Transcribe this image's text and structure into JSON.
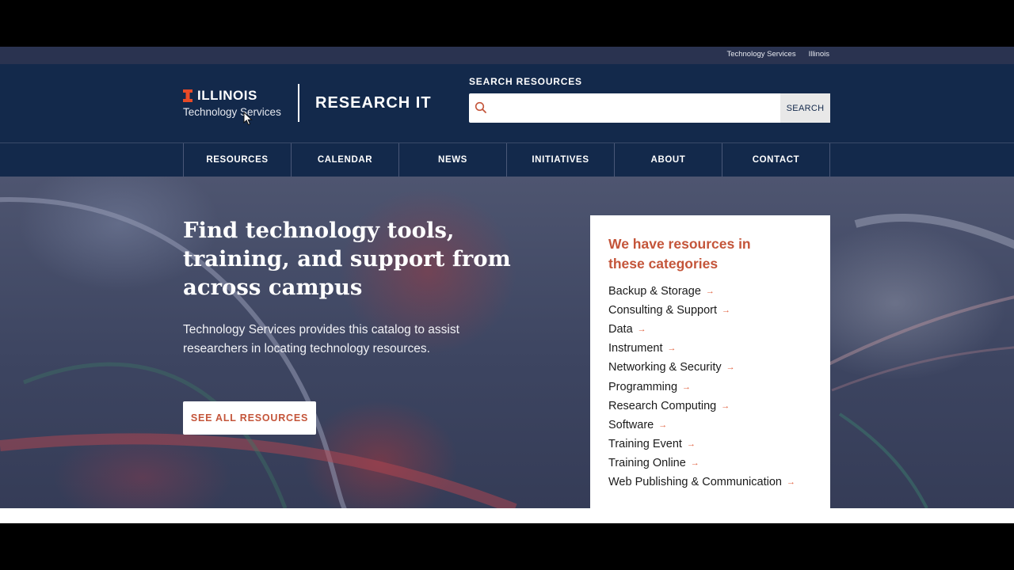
{
  "utility": {
    "links": [
      "Technology Services",
      "Illinois"
    ]
  },
  "brand": {
    "name": "ILLINOIS",
    "sub": "Technology Services",
    "site_title": "RESEARCH IT",
    "accent": "#e84a27",
    "navy": "#13294b"
  },
  "search": {
    "label": "SEARCH RESOURCES",
    "placeholder": "",
    "value": "",
    "button": "SEARCH",
    "icon": "search-icon"
  },
  "nav": {
    "items": [
      "RESOURCES",
      "CALENDAR",
      "NEWS",
      "INITIATIVES",
      "ABOUT",
      "CONTACT"
    ]
  },
  "hero": {
    "heading": "Find technology tools, training, and support from across campus",
    "text": "Technology Services provides this catalog to assist researchers in locating technology resources.",
    "button": "SEE ALL RESOURCES"
  },
  "categories": {
    "title": "We have resources in these categories",
    "arrow": "→",
    "items": [
      "Backup & Storage",
      "Consulting & Support",
      "Data",
      "Instrument",
      "Networking & Security",
      "Programming",
      "Research Computing",
      "Software",
      "Training Event",
      "Training Online",
      "Web Publishing & Communication"
    ],
    "accent": "#c4553a"
  }
}
